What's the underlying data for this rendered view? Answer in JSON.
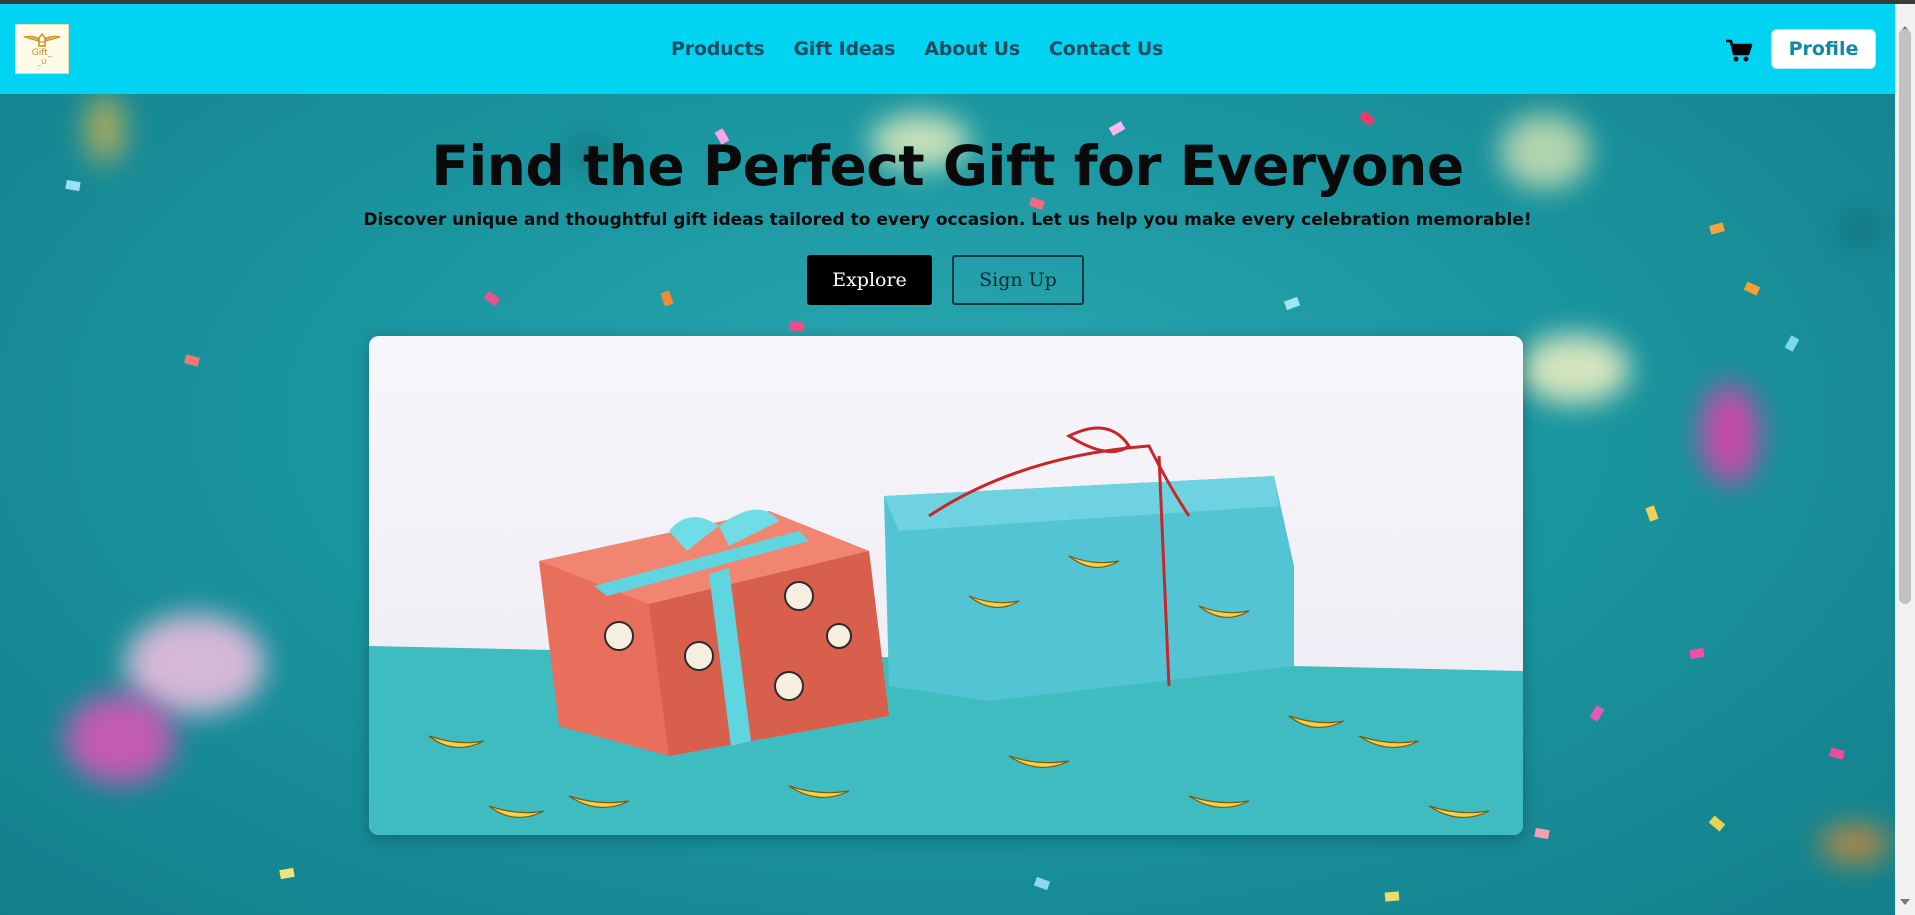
{
  "logo": {
    "line1": "Gift_",
    "line2": "_U"
  },
  "nav": {
    "links": [
      "Products",
      "Gift Ideas",
      "About Us",
      "Contact Us"
    ],
    "cart_icon": "shopping-cart-icon",
    "profile_label": "Profile"
  },
  "hero": {
    "title": "Find the Perfect Gift for Everyone",
    "subtitle": "Discover unique and thoughtful gift ideas tailored to every occasion. Let us help you make every celebration memorable!",
    "explore_label": "Explore",
    "signup_label": "Sign Up"
  },
  "colors": {
    "navbar": "#00d4f2",
    "nav_text": "#1f4c5f",
    "profile_text": "#0e8aa8",
    "hero_bg": "#1a96a0"
  }
}
